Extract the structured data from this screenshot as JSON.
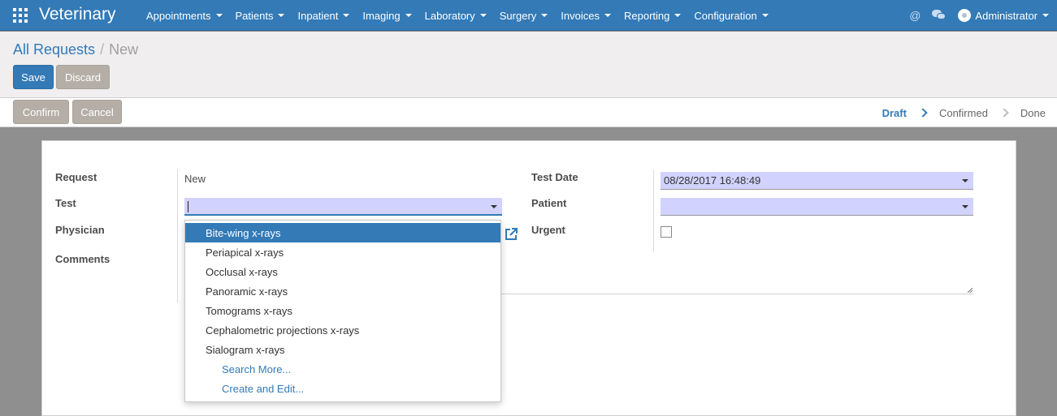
{
  "navbar": {
    "brand": "Veterinary",
    "menu": [
      {
        "label": "Appointments"
      },
      {
        "label": "Patients"
      },
      {
        "label": "Inpatient"
      },
      {
        "label": "Imaging"
      },
      {
        "label": "Laboratory"
      },
      {
        "label": "Surgery"
      },
      {
        "label": "Invoices"
      },
      {
        "label": "Reporting"
      },
      {
        "label": "Configuration"
      }
    ],
    "at_symbol": "@",
    "user": "Administrator",
    "brand_color": "#337ab7"
  },
  "breadcrumb": {
    "parent": "All Requests",
    "separator": "/",
    "current": "New"
  },
  "buttons": {
    "save": "Save",
    "discard": "Discard",
    "confirm": "Confirm",
    "cancel": "Cancel"
  },
  "status": {
    "stages": [
      {
        "label": "Draft",
        "active": true
      },
      {
        "label": "Confirmed",
        "active": false
      },
      {
        "label": "Done",
        "active": false
      }
    ]
  },
  "form": {
    "labels": {
      "request": "Request",
      "test": "Test",
      "physician": "Physician",
      "comments": "Comments",
      "test_date": "Test Date",
      "patient": "Patient",
      "urgent": "Urgent"
    },
    "request_value": "New",
    "test_value": "",
    "test_date_value": "08/28/2017 16:48:49",
    "patient_value": "",
    "urgent_checked": false
  },
  "dropdown": {
    "items": [
      "Bite-wing x-rays",
      "Periapical x-rays",
      "Occlusal x-rays",
      "Panoramic x-rays",
      "Tomograms x-rays",
      "Cephalometric projections x-rays",
      "Sialogram x-rays"
    ],
    "search_more": "Search More...",
    "create_edit": "Create and Edit...",
    "highlighted_index": 0
  },
  "icons": [
    "apps-grid-icon",
    "at-icon",
    "chat-icon",
    "avatar-icon",
    "external-link-icon",
    "chevron-right-icon",
    "caret-down-icon"
  ]
}
